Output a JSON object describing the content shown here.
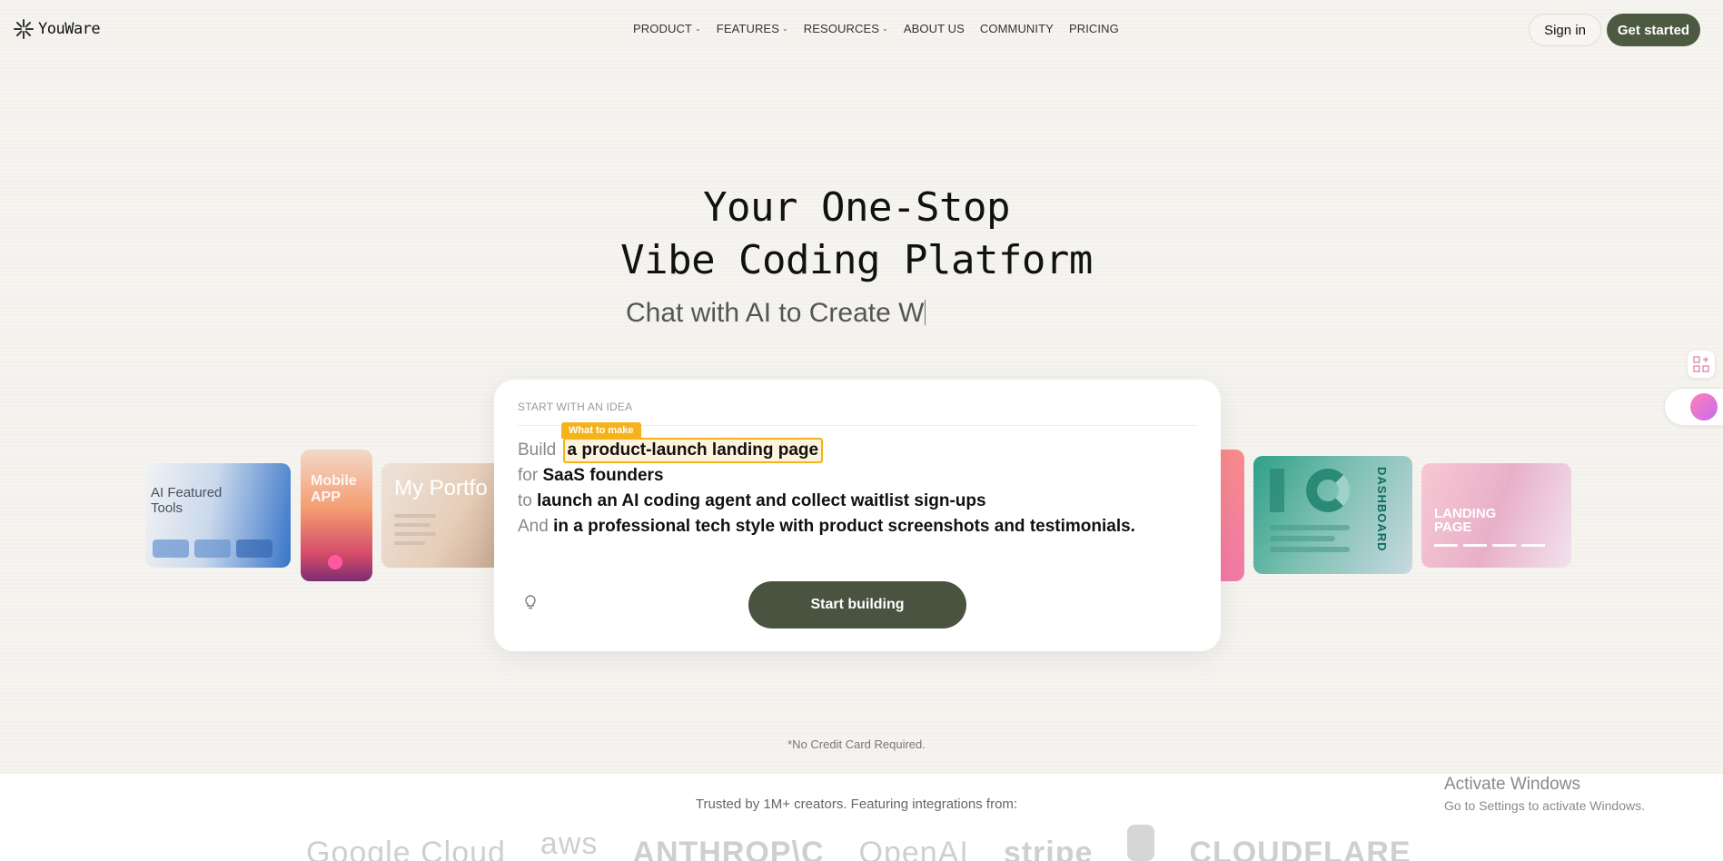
{
  "nav": {
    "brand": "YouWare",
    "items": [
      {
        "label": "PRODUCT",
        "caret": true
      },
      {
        "label": "FEATURES",
        "caret": true
      },
      {
        "label": "RESOURCES",
        "caret": true
      },
      {
        "label": "ABOUT US",
        "caret": false
      },
      {
        "label": "COMMUNITY",
        "caret": false
      },
      {
        "label": "PRICING",
        "caret": false
      }
    ],
    "signin_label": "Sign in",
    "get_started_label": "Get started",
    "caret_glyph": "⌄"
  },
  "hero": {
    "title_line1": "Your One-Stop",
    "title_line2": "Vibe Coding Platform",
    "typing_text": "Chat with AI to Create W"
  },
  "cards": {
    "ai_featured": "AI Featured Tools",
    "mobile_app": "Mobile APP",
    "portfolio": "My Portfo",
    "dashboard": "DASHBOARD",
    "landing_page": "LANDING PAGE"
  },
  "prompt": {
    "section_label": "START WITH AN IDEA",
    "tooltip": "What to make",
    "lines": [
      {
        "prefix": "Build",
        "value": "a product-launch landing page"
      },
      {
        "prefix": "for",
        "value": "SaaS founders"
      },
      {
        "prefix": "to",
        "value": "launch an AI coding agent and collect waitlist sign-ups"
      },
      {
        "prefix": "And",
        "value": "in a professional tech style with product screenshots and testimonials."
      }
    ],
    "start_button": "Start building",
    "bulb_icon": "lightbulb-icon"
  },
  "no_credit": "*No Credit Card Required.",
  "trusted": {
    "text": "Trusted by 1M+ creators. Featuring integrations from:",
    "logos": [
      "Google Cloud",
      "aws",
      "ANTHROP\\C",
      "OpenAI",
      "stripe",
      "",
      "CLOUDFLARE"
    ]
  },
  "windows_watermark": {
    "line1": "Activate Windows",
    "line2": "Go to Settings to activate Windows."
  },
  "colors": {
    "accent": "#4c5a42",
    "highlight": "#f2b417",
    "background": "#f5f3ef"
  }
}
